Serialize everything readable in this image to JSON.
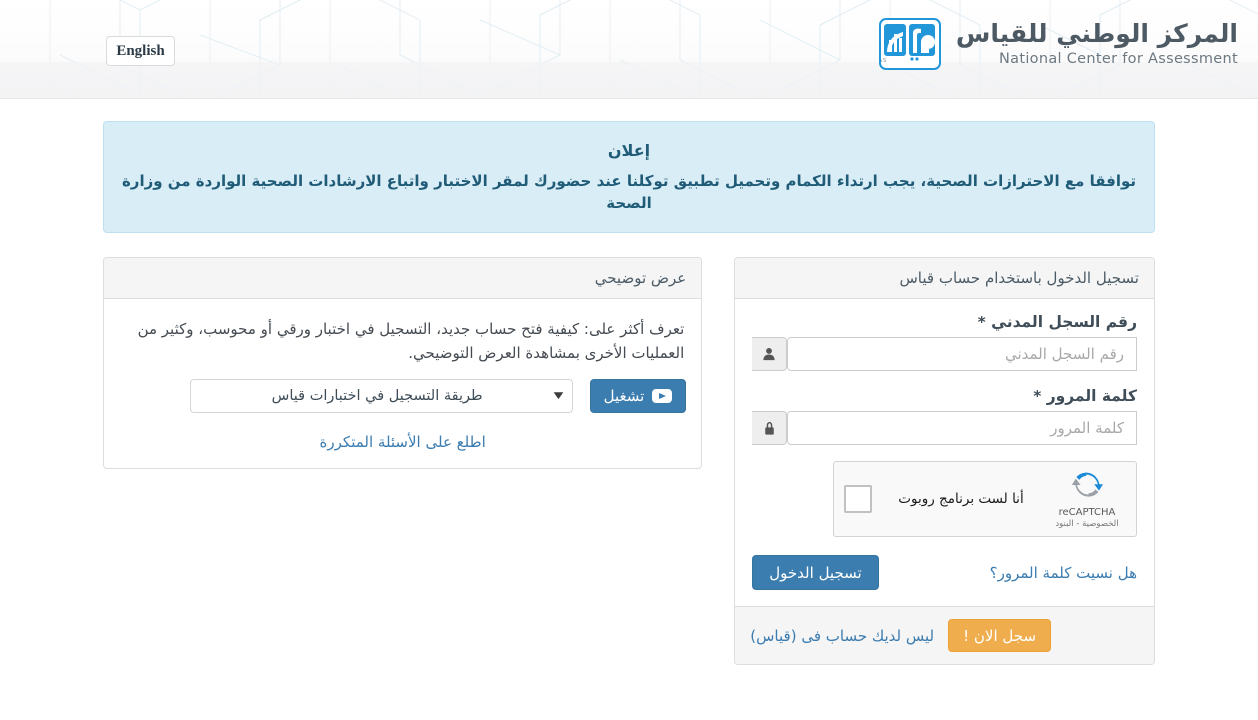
{
  "header": {
    "language_button": "English",
    "brand_arabic": "المركز الوطني للقياس",
    "brand_english": "National Center for Assessment",
    "logo_text": "QIYAS"
  },
  "announcement": {
    "title": "إعلان",
    "body": "توافقا مع الاحترازات الصحية، يجب ارتداء الكمام وتحميل تطبيق توكلنا عند حضورك لمقر الاختبار واتباع الارشادات الصحية الواردة من وزارة الصحة"
  },
  "demo_panel": {
    "heading": "عرض توضيحي",
    "description": "تعرف أكثر على: كيفية فتح حساب جديد، التسجيل في اختبار ورقي أو محوسب، وكثير من العمليات الأخرى بمشاهدة العرض التوضيحي.",
    "select_value": "طريقة التسجيل في اختبارات قياس",
    "play_button": "تشغيل",
    "faq_link": "اطلع على الأسئلة المتكررة"
  },
  "login_panel": {
    "heading": "تسجيل الدخول باستخدام حساب قياس",
    "national_id_label": "رقم السجل المدني *",
    "national_id_placeholder": "رقم السجل المدني",
    "national_id_value": "",
    "password_label": "كلمة المرور *",
    "password_placeholder": "كلمة المرور",
    "password_value": "",
    "recaptcha_label": "أنا لست برنامج روبوت",
    "recaptcha_brand": "reCAPTCHA",
    "recaptcha_terms": "الخصوصية - البنود",
    "forgot_password": "هل نسيت كلمة المرور؟",
    "login_button": "تسجيل الدخول",
    "no_account_text": "ليس لديك حساب فى (قياس)",
    "register_button": "سجل الان !"
  },
  "colors": {
    "primary_blue": "#3c7db0",
    "link_blue": "#3b7cb0",
    "orange": "#f0ad4e",
    "alert_bg": "#d9edf7",
    "alert_text": "#205c78",
    "logo_blue": "#2196d8"
  }
}
